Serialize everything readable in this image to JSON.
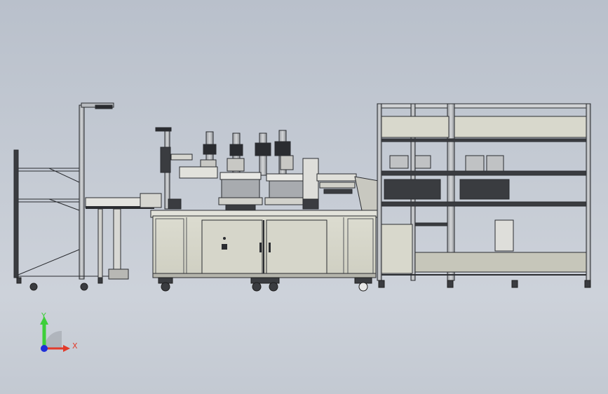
{
  "triad": {
    "y_label": "Y",
    "x_label": "X",
    "y_color": "#3ecf3a",
    "x_color": "#e23a2a",
    "z_color": "#1f2fd8"
  },
  "palette": {
    "frame": "#8c8f93",
    "panel": "#d8d8cc",
    "dark": "#2a2c30"
  }
}
